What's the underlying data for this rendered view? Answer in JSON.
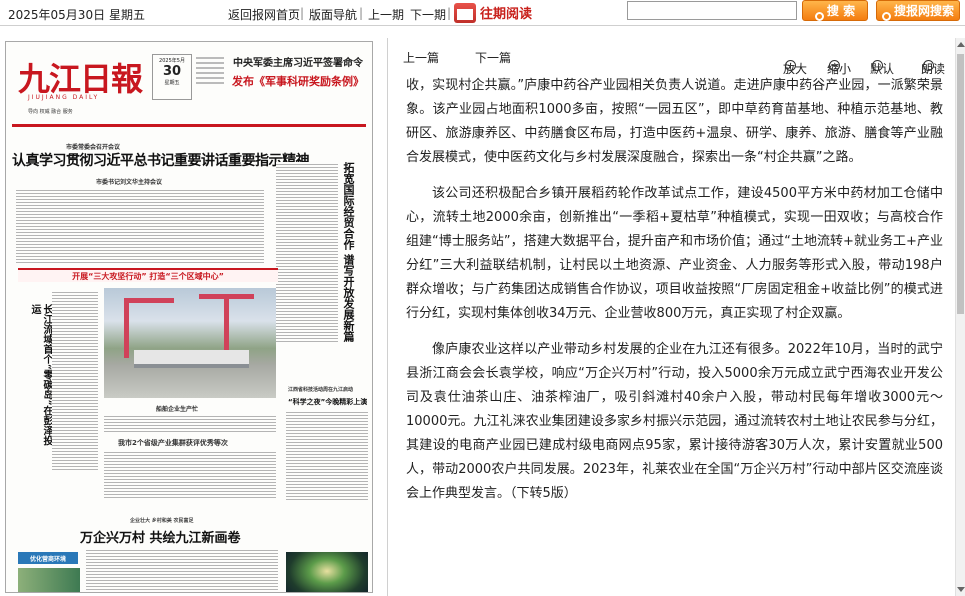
{
  "toolbar": {
    "date": "2025年05月30日",
    "weekday": "星期五",
    "home": "返回报网首页",
    "layout_nav": "版面导航",
    "prev_issue": "上一期",
    "next_issue": "下一期",
    "history": "往期阅读",
    "search_btn": "搜 索",
    "site_search_btn": "搜报网搜索"
  },
  "newspaper": {
    "masthead": "九江日報",
    "masthead_pinyin": "JIUJIANG DAILY",
    "slogan": "导向  权威  融合  服务",
    "date_top": "2025年5月",
    "date_day": "30",
    "date_weekday": "星期五",
    "top_news_line1": "中央军委主席习近平签署命令",
    "top_news_line2": "发布《军事科研奖励条例》",
    "kicker": "市委常委会召开会议",
    "headline": "认真学习贯彻习近平总书记重要讲话重要指示精神",
    "subkicker": "市委书记刘文华主持会议",
    "right_vertical_head": "拓宽国际经贸合作 谱写开放发展新篇",
    "left_vertical_head": "长江流域首个“零碳岛”在彭泽投运",
    "banner": "开展“三大攻坚行动” 打造“三个区域中心”",
    "photo_caption": "船舶企业生产忙",
    "caption2": "我市2个省级产业集群获评优秀等次",
    "side_caption": "江西省科技活动周在九江启动",
    "side_caption2": "“科学之夜”今晚精彩上演",
    "bottom_kicker": "企业壮大 乡村和美 农民富足",
    "bottom_head": "万企兴万村 共绘九江新画卷",
    "bluebox": "优化营商环境"
  },
  "reader": {
    "prev": "上一篇",
    "next": "下一篇",
    "zoom_in": "放大",
    "zoom_out": "缩小",
    "default": "默认",
    "read_aloud": "朗读"
  },
  "article": {
    "paragraphs": [
      "收，实现村企共赢。”庐康中药谷产业园相关负责人说道。走进庐康中药谷产业园，一派繁荣景象。该产业园占地面积1000多亩，按照“一园五区”，即中草药育苗基地、种植示范基地、教研区、旅游康养区、中药膳食区布局，打造中医药+温泉、研学、康养、旅游、膳食等产业融合发展模式，使中医药文化与乡村发展深度融合，探索出一条“村企共赢”之路。",
      "该公司还积极配合乡镇开展稻药轮作改革试点工作，建设4500平方米中药材加工仓储中心，流转土地2000余亩，创新推出“一季稻+夏枯草”种植模式，实现一田双收；与高校合作组建“博士服务站”，搭建大数据平台，提升亩产和市场价值；通过“土地流转+就业务工+产业分红”三大利益联结机制，让村民以土地资源、产业资金、人力服务等形式入股，带动198户群众增收；与广药集团达成销售合作协议，项目收益按照“厂房固定租金+收益比例”的模式进行分红，实现村集体创收34万元、企业营收800万元，真正实现了村企双赢。",
      "像庐康农业这样以产业带动乡村发展的企业在九江还有很多。2022年10月，当时的武宁县浙江商会会长袁学校，响应“万企兴万村”行动，投入5000余万元成立武宁西海农业开发公司及袁仕油茶山庄、油茶榨油厂，吸引斜滩村40余户入股，带动村民每年增收3000元～10000元。九江礼涞农业集团建设多家乡村振兴示范园，通过流转农村土地让农民参与分红，其建设的电商产业园已建成村级电商网点95家，累计接待游客30万人次，累计安置就业500人，带动2000农户共同发展。2023年，礼莱农业在全国“万企兴万村”行动中部片区交流座谈会上作典型发言。（下转5版）"
    ]
  }
}
